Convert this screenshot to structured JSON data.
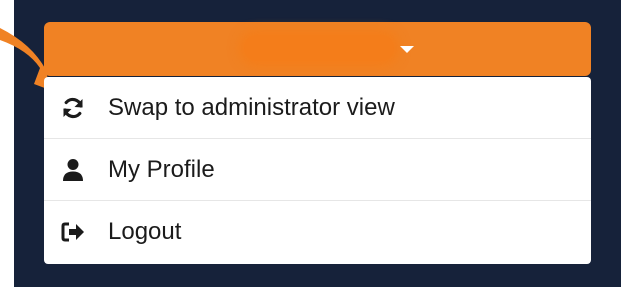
{
  "toggle": {
    "label": "",
    "icon": "caret-down-icon",
    "color": "#f08224"
  },
  "menu": {
    "items": [
      {
        "label": "Swap to administrator view",
        "icon": "sync-icon"
      },
      {
        "label": "My Profile",
        "icon": "user-icon"
      },
      {
        "label": "Logout",
        "icon": "sign-out-icon"
      }
    ]
  },
  "colors": {
    "panel": "#16223a",
    "accent": "#f08224",
    "menu_bg": "#ffffff",
    "text": "#1b1b1b"
  }
}
